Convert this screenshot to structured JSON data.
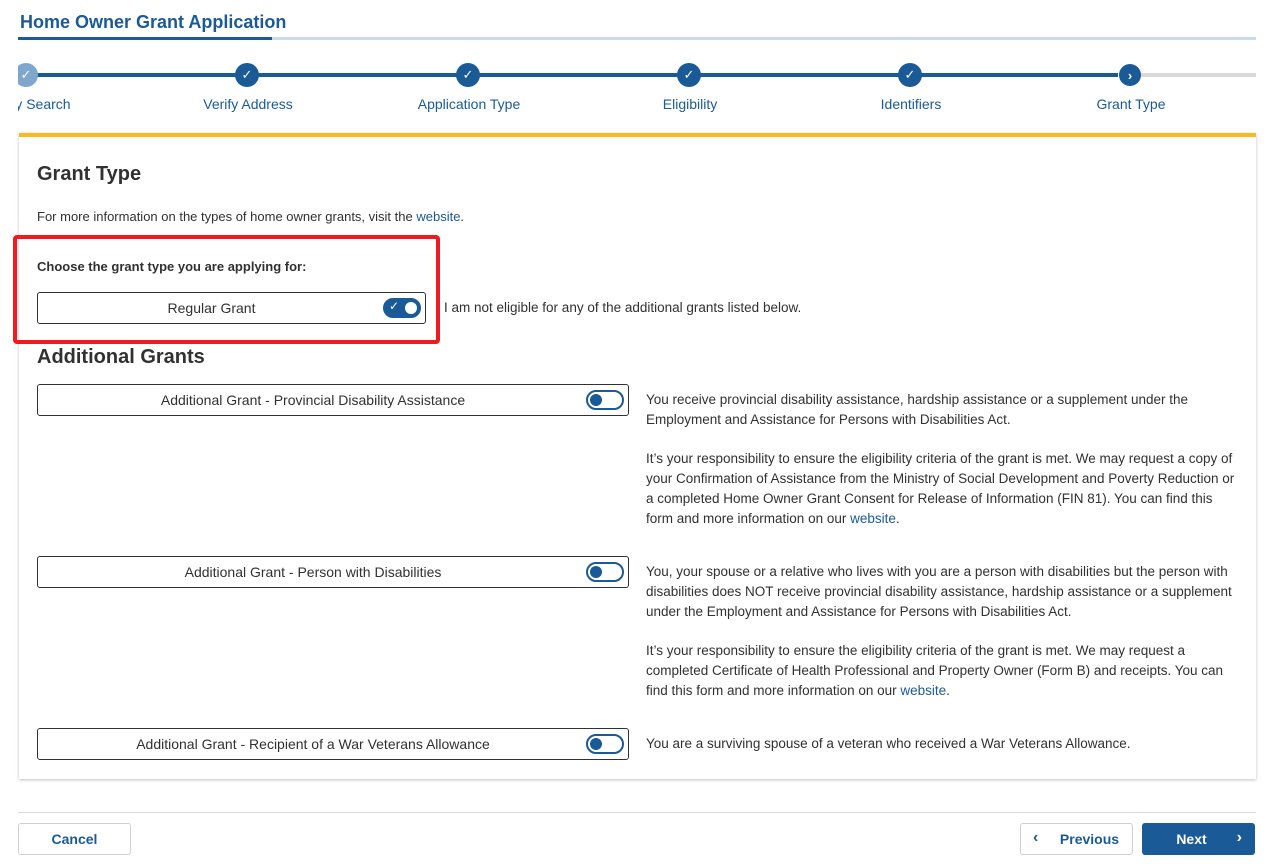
{
  "header": {
    "title": "Home Owner Grant Application"
  },
  "stepper": {
    "steps": [
      {
        "label": "ty Search",
        "status": "complete"
      },
      {
        "label": "Verify Address",
        "status": "complete"
      },
      {
        "label": "Application Type",
        "status": "complete"
      },
      {
        "label": "Eligibility",
        "status": "complete"
      },
      {
        "label": "Identifiers",
        "status": "complete"
      },
      {
        "label": "Grant Type",
        "status": "current"
      }
    ],
    "check_glyph": "✓",
    "current_glyph": "›"
  },
  "main": {
    "heading": "Grant Type",
    "info_text": "For more information on the types of home owner grants, visit the ",
    "info_link": "website",
    "info_suffix": ".",
    "choose_label": "Choose the grant type you are applying for:",
    "regular": {
      "label": "Regular Grant",
      "enabled": true,
      "description": "I am not eligible for any of the additional grants listed below."
    },
    "additional_heading": "Additional Grants",
    "additional": [
      {
        "label": "Additional Grant - Provincial Disability Assistance",
        "enabled": false,
        "description": "You receive provincial disability assistance, hardship assistance or a supplement under the Employment and Assistance for Persons with Disabilities Act.",
        "responsibility": "It’s your responsibility to ensure the eligibility criteria of the grant is met. We may request a copy of your Confirmation of Assistance from the Ministry of Social Development and Poverty Reduction or a completed Home Owner Grant Consent for Release of Information (FIN 81). You can find this form and more information on our ",
        "link": "website",
        "suffix": "."
      },
      {
        "label": "Additional Grant - Person with Disabilities",
        "enabled": false,
        "description": "You, your spouse or a relative who lives with you are a person with disabilities but the person with disabilities does NOT receive provincial disability assistance, hardship assistance or a supplement under the Employment and Assistance for Persons with Disabilities Act.",
        "responsibility": "It’s your responsibility to ensure the eligibility criteria of the grant is met. We may request a completed Certificate of Health Professional and Property Owner (Form B) and receipts. You can find this form and more information on our ",
        "link": "website",
        "suffix": "."
      },
      {
        "label": "Additional Grant - Recipient of a War Veterans Allowance",
        "enabled": false,
        "description": "You are a surviving spouse of a veteran who received a War Veterans Allowance."
      }
    ]
  },
  "footer": {
    "cancel_label": "Cancel",
    "previous_label": "Previous",
    "next_label": "Next",
    "prev_glyph": "‹",
    "next_glyph": "›"
  },
  "colors": {
    "primary": "#1a5a96",
    "accent": "#fcba19",
    "highlight": "#ee1c1c"
  }
}
